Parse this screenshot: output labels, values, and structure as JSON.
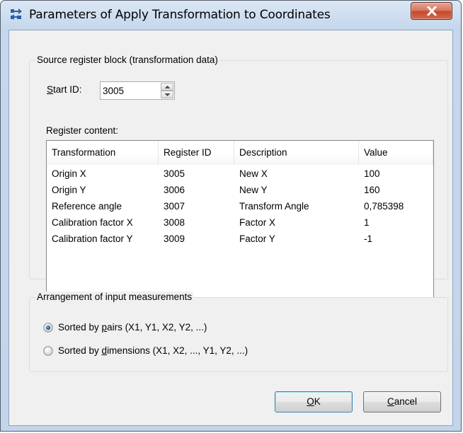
{
  "window": {
    "title": "Parameters of Apply Transformation to Coordinates",
    "icons": {
      "app": "transform-arrows-icon",
      "close": "close-icon"
    }
  },
  "source_group": {
    "title": "Source register block (transformation data)",
    "start_id_mnemonic": "S",
    "start_id_rest": "tart ID:",
    "start_id_value": "3005",
    "register_content_label": "Register content:",
    "columns": [
      "Transformation",
      "Register ID",
      "Description",
      "Value"
    ],
    "rows": [
      [
        "Origin X",
        "3005",
        "New X",
        "100"
      ],
      [
        "Origin Y",
        "3006",
        "New Y",
        "160"
      ],
      [
        "Reference angle",
        "3007",
        "Transform Angle",
        "0,785398"
      ],
      [
        "Calibration factor X",
        "3008",
        "Factor X",
        "1"
      ],
      [
        "Calibration factor Y",
        "3009",
        "Factor Y",
        "-1"
      ]
    ]
  },
  "arrangement_group": {
    "title": "Arrangement of input measurements",
    "options": [
      {
        "pre": "Sorted by ",
        "mnemonic": "p",
        "post": "airs (X1, Y1, X2, Y2, ...)",
        "selected": true
      },
      {
        "pre": "Sorted by ",
        "mnemonic": "d",
        "post": "imensions (X1, X2, ..., Y1, Y2, ...)",
        "selected": false
      }
    ]
  },
  "buttons": {
    "ok_mnemonic": "O",
    "ok_rest": "K",
    "cancel_mnemonic": "C",
    "cancel_rest": "ancel"
  },
  "colors": {
    "titlebar": "#c5d7ec",
    "client": "#f0f0f0",
    "close_button": "#c7482b",
    "default_button_border": "#3c7fb1"
  }
}
